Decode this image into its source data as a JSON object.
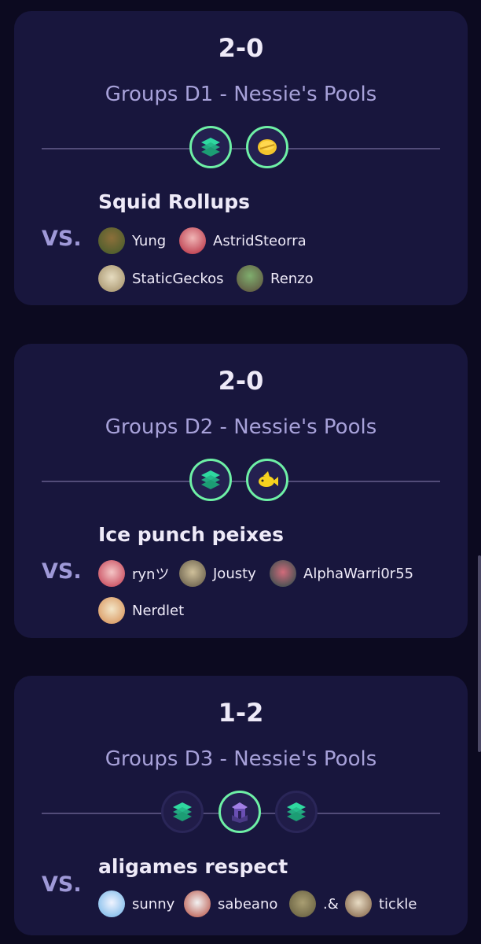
{
  "matches": [
    {
      "score": "2-0",
      "group": "Groups D1 - Nessie's Pools",
      "team": "Squid Rollups",
      "vs_label": "VS.",
      "icons": [
        "stack-emblem-icon",
        "gold-coin-emblem-icon"
      ],
      "players": [
        "Yung",
        "AstridSteorra",
        "StaticGeckos",
        "Renzo"
      ]
    },
    {
      "score": "2-0",
      "group": "Groups D2 - Nessie's Pools",
      "team": "Ice punch peixes",
      "vs_label": "VS.",
      "icons": [
        "stack-emblem-icon",
        "yellow-fish-emblem-icon"
      ],
      "players": [
        "rynツ",
        "Jousty",
        "AlphaWarri0r55",
        "Nerdlet"
      ]
    },
    {
      "score": "1-2",
      "group": "Groups D3 - Nessie's Pools",
      "team": "aligames respect",
      "vs_label": "VS.",
      "icons": [
        "stack-emblem-icon",
        "purple-tower-emblem-icon",
        "stack-emblem-icon"
      ],
      "players": [
        "sunny",
        "sabeano",
        ".&",
        "tickle"
      ]
    }
  ],
  "colors": {
    "background": "#0c0a20",
    "card": "#18163d",
    "win_ring": "#6ef0a6",
    "group_text": "#a7a1d9"
  }
}
